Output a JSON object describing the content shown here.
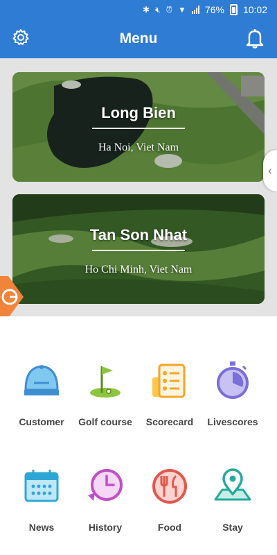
{
  "status_bar": {
    "battery": "76%",
    "time": "10:02",
    "icons": [
      "bluetooth-icon",
      "mute-icon",
      "alarm-icon",
      "wifi-icon",
      "signal-icon",
      "battery-icon"
    ]
  },
  "header": {
    "title": "Menu",
    "left_icon": "gear-icon",
    "right_icon": "bell-icon",
    "background": "#2f7cd4"
  },
  "courses": [
    {
      "name": "Long Bien",
      "location": "Ha Noi, Viet Nam"
    },
    {
      "name": "Tan Son Nhat",
      "location": "Ho Chi Minh, Viet Nam"
    }
  ],
  "menu": [
    {
      "label": "Customer",
      "icon": "cap-icon"
    },
    {
      "label": "Golf course",
      "icon": "golf-flag-icon"
    },
    {
      "label": "Scorecard",
      "icon": "scorecard-icon"
    },
    {
      "label": "Livescores",
      "icon": "stopwatch-icon"
    },
    {
      "label": "News",
      "icon": "calendar-icon"
    },
    {
      "label": "History",
      "icon": "history-clock-icon"
    },
    {
      "label": "Food",
      "icon": "fork-knife-icon"
    },
    {
      "label": "Stay",
      "icon": "map-pin-icon"
    }
  ]
}
